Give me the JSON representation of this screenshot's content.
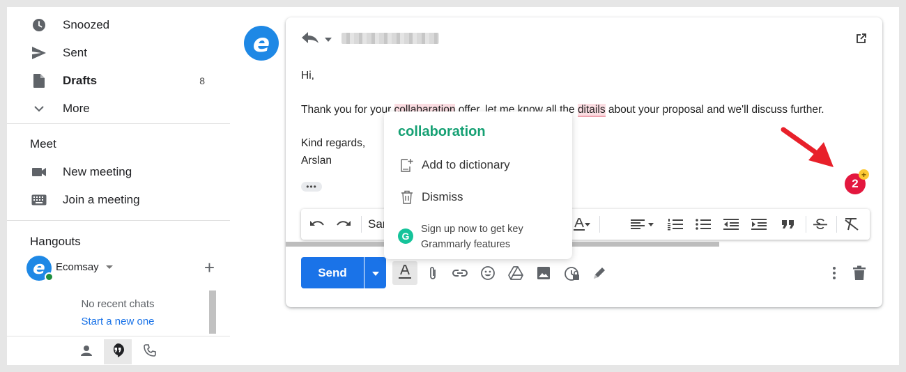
{
  "sidebar": {
    "items": [
      {
        "label": "Snoozed",
        "icon": "clock-icon",
        "count": ""
      },
      {
        "label": "Sent",
        "icon": "send-icon",
        "count": ""
      },
      {
        "label": "Drafts",
        "icon": "draft-icon",
        "count": "8"
      },
      {
        "label": "More",
        "icon": "chevron-down-icon",
        "count": ""
      }
    ],
    "meet": {
      "title": "Meet",
      "items": [
        {
          "label": "New meeting",
          "icon": "video-camera-icon"
        },
        {
          "label": "Join a meeting",
          "icon": "keyboard-icon"
        }
      ]
    },
    "hangouts": {
      "title": "Hangouts",
      "user": "Ecomsay",
      "no_chats": "No recent chats",
      "start_new": "Start a new one"
    }
  },
  "email": {
    "greeting": "Hi,",
    "line_pre": "Thank you for your ",
    "misspelled_1": "collabaration",
    "line_mid": " offer, let me know all the ",
    "misspelled_2": "ditails",
    "line_post": " about your proposal and we'll discuss further.",
    "signoff": "Kind regards,",
    "signature": "Arslan",
    "toolbar_font": "Sar"
  },
  "compose": {
    "send_label": "Send"
  },
  "grammarly": {
    "badge_count": "2",
    "badge_plus": "+",
    "suggestion": "collaboration",
    "add_to_dictionary": "Add to dictionary",
    "dismiss": "Dismiss",
    "signup_line1": "Sign up now to get key",
    "signup_line2": "Grammarly features",
    "logo_letter": "G"
  },
  "avatar_letter": "e",
  "colors": {
    "accent": "#1a73e8",
    "grammarly_green": "#15a073",
    "error_red": "#e3173e"
  }
}
